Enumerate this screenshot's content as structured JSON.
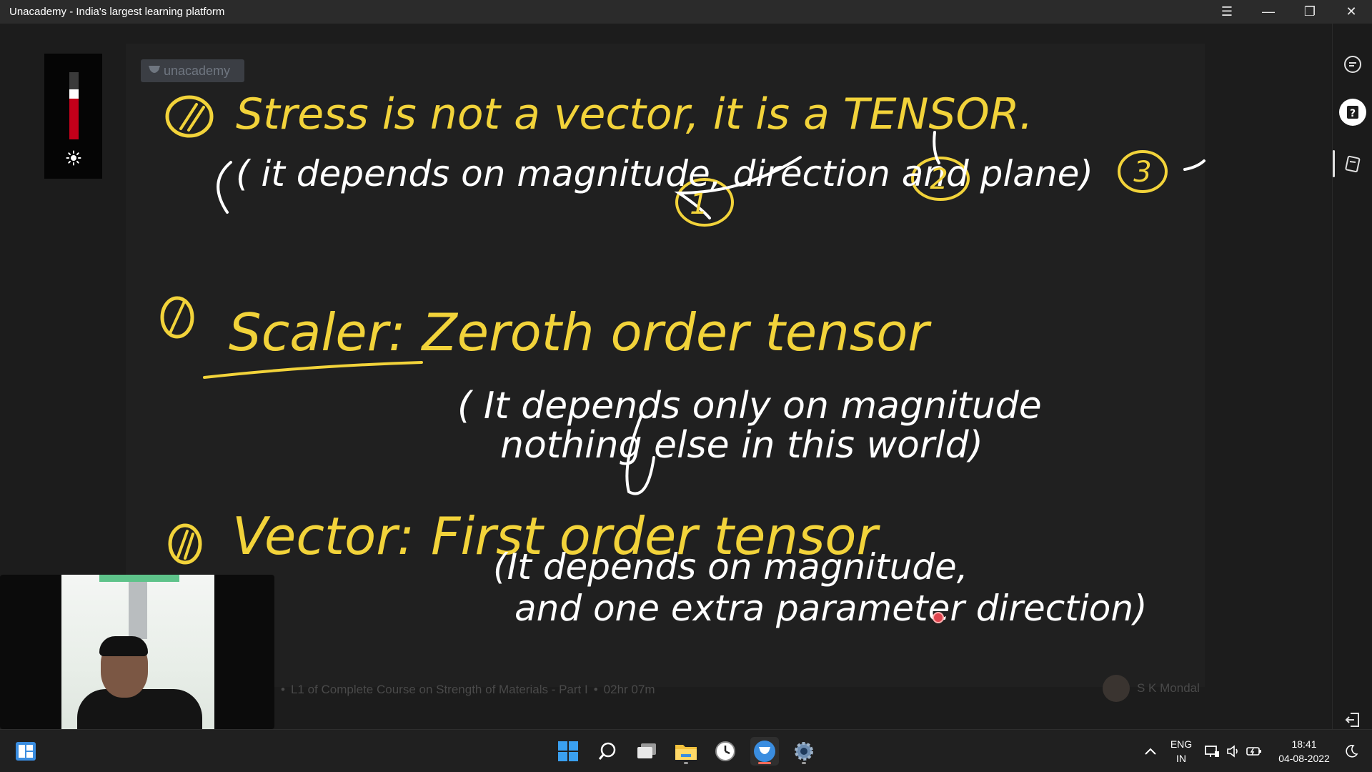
{
  "window": {
    "title": "Unacademy - India's largest learning platform",
    "controls": {
      "menu": "☰",
      "minimize": "—",
      "restore": "❐",
      "close": "✕"
    }
  },
  "brightness": {
    "level": 0.3
  },
  "logo": {
    "text": "unacademy"
  },
  "slide": {
    "lines": [
      {
        "marker": "i",
        "text": "Stress is not a vector, it is a TENSOR."
      },
      {
        "text": "( it depends on magnitude, direction and plane)"
      },
      {
        "badges": [
          "1",
          "2",
          "3"
        ]
      },
      {
        "marker": "i",
        "text": "Scaler: Zeroth order tensor"
      },
      {
        "text": "( It depends only on magnitude"
      },
      {
        "text": "nothing else in this world)"
      },
      {
        "marker": "ii",
        "text": "Vector: First order tensor"
      },
      {
        "text": "(It depends on magnitude,"
      },
      {
        "text": "and one extra parameter direction)"
      }
    ]
  },
  "footer": {
    "course": "L1 of Complete Course on Strength of Materials - Part I",
    "duration": "02hr 07m",
    "educator": "S K Mondal"
  },
  "taskbar": {
    "lang_top": "ENG",
    "lang_bottom": "IN",
    "time": "18:41",
    "date": "04-08-2022",
    "icons": [
      "widgets-icon",
      "windows-start-icon",
      "search-icon",
      "task-view-icon",
      "file-explorer-icon",
      "clock-app-icon",
      "unacademy-app-icon",
      "settings-icon"
    ]
  },
  "colors": {
    "ink": "#f2d33a",
    "ink_white": "#ffffff",
    "accent_red": "#c4001a",
    "background": "#1f1f1f"
  }
}
